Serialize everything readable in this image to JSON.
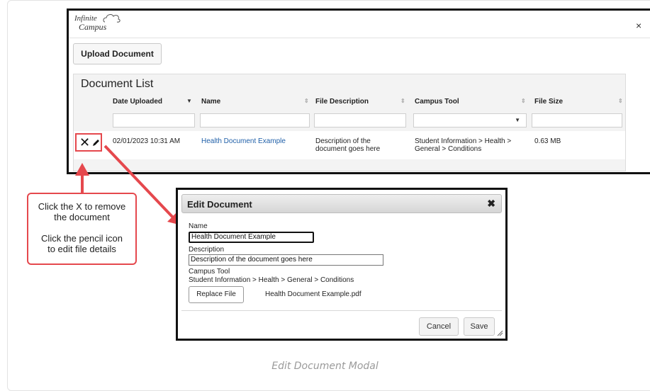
{
  "app": {
    "logo_line1": "Infinite",
    "logo_line2": "Campus",
    "close_glyph": "×"
  },
  "toolbar": {
    "upload_label": "Upload Document"
  },
  "document_list": {
    "title": "Document List",
    "columns": [
      "Date Uploaded",
      "Name",
      "File Description",
      "Campus Tool",
      "File Size"
    ],
    "sorted_column": "Date Uploaded",
    "rows": [
      {
        "date": "02/01/2023 10:31 AM",
        "name": "Health Document Example",
        "description_line1": "Description of the",
        "description_line2": "document goes here",
        "tool_line1": "Student Information > Health >",
        "tool_line2": "General > Conditions",
        "size": "0.63 MB"
      }
    ],
    "row_actions": {
      "remove_icon": "close-icon",
      "edit_icon": "pencil-icon"
    }
  },
  "callout": {
    "line1": "Click the X to remove",
    "line2": "the document",
    "line3": "Click the pencil icon",
    "line4": "to edit file details"
  },
  "modal": {
    "title": "Edit Document",
    "name_label": "Name",
    "name_value": "Health Document Example",
    "description_label": "Description",
    "description_value": "Description of the document goes here",
    "campus_tool_label": "Campus Tool",
    "campus_tool_value": "Student Information > Health > General > Conditions",
    "replace_label": "Replace File",
    "file_name": "Health Document Example.pdf",
    "cancel_label": "Cancel",
    "save_label": "Save"
  },
  "caption": "Edit Document Modal",
  "colors": {
    "highlight": "#e5484d",
    "link": "#1f5fa8",
    "frame": "#111111"
  }
}
